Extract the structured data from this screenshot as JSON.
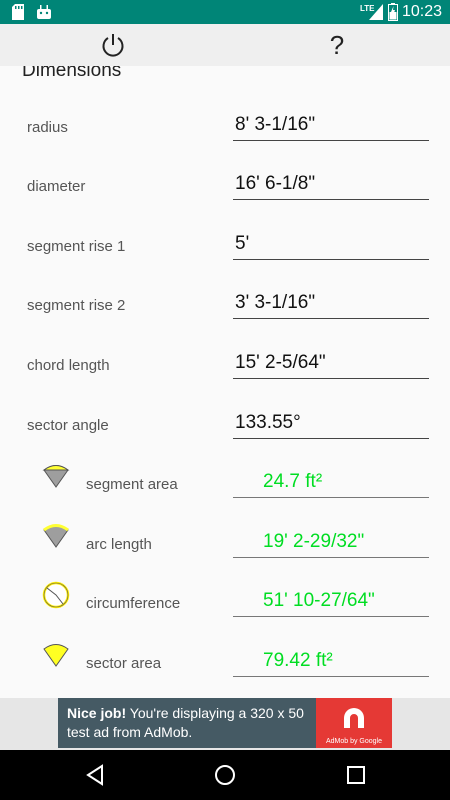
{
  "status_bar": {
    "time": "10:23",
    "network": "LTE",
    "icons": [
      "sd-card-icon",
      "android-icon",
      "signal-icon",
      "battery-icon"
    ],
    "background": "#008577"
  },
  "action_bar": {
    "power_icon": "power-icon",
    "help_label": "?"
  },
  "section": {
    "title": "Dimensions"
  },
  "inputs": [
    {
      "label": "radius",
      "value": "8' 3-1/16\""
    },
    {
      "label": "diameter",
      "value": "16' 6-1/8\""
    },
    {
      "label": "segment rise 1",
      "value": "5'"
    },
    {
      "label": "segment rise 2",
      "value": "3' 3-1/16\""
    },
    {
      "label": "chord length",
      "value": "15' 2-5/64\""
    },
    {
      "label": "sector angle",
      "value": "133.55°"
    }
  ],
  "results": [
    {
      "label": "segment area",
      "value": "24.7 ft²",
      "icon": "segment-area-icon"
    },
    {
      "label": "arc length",
      "value": "19' 2-29/32\"",
      "icon": "arc-length-icon"
    },
    {
      "label": "circumference",
      "value": "51' 10-27/64\"",
      "icon": "circumference-icon"
    },
    {
      "label": "sector area",
      "value": "79.42 ft²",
      "icon": "sector-area-icon"
    }
  ],
  "result_color": "#00dd22",
  "ad": {
    "headline": "Nice job!",
    "body": "You're displaying a 320 x 50 test ad from AdMob.",
    "logo_caption": "AdMob by Google"
  },
  "nav": {
    "back_icon": "back-icon",
    "home_icon": "home-icon",
    "recents_icon": "recents-icon"
  }
}
